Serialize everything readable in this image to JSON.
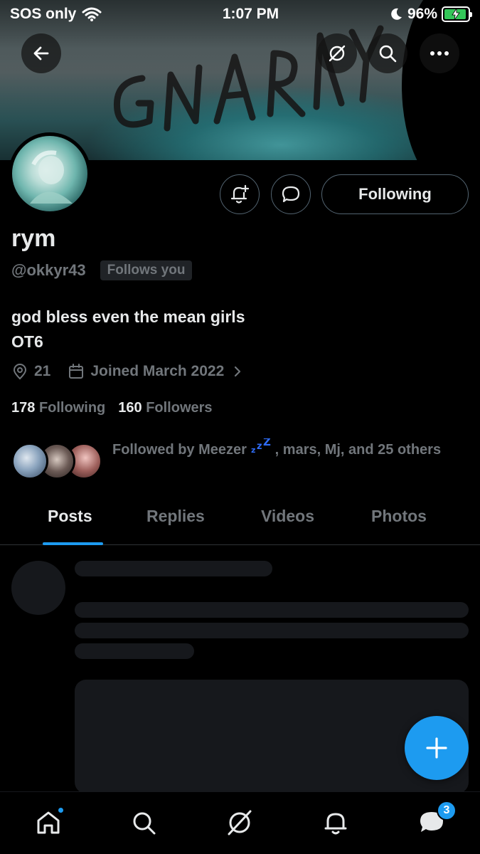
{
  "status_bar": {
    "carrier": "SOS only",
    "time": "1:07 PM",
    "battery": "96%",
    "battery_level": 0.96
  },
  "banner": {
    "graffiti_text": "GNARLY"
  },
  "profile": {
    "name": "rym",
    "handle": "@okkyr43",
    "follows_you": "Follows you",
    "bio_line1": "god bless even the mean girls",
    "bio_line2": "OT6",
    "location": "21",
    "joined": "Joined March 2022",
    "following_count": "178",
    "following_label": "Following",
    "followers_count": "160",
    "followers_label": "Followers",
    "followed_by_prefix": "Followed by Meezer",
    "followed_by_emoji": "zzz",
    "followed_by_suffix": ", mars, Mj, and 25 others"
  },
  "actions": {
    "following_button": "Following"
  },
  "tabs": [
    {
      "label": "Posts",
      "active": true
    },
    {
      "label": "Replies",
      "active": false
    },
    {
      "label": "Videos",
      "active": false
    },
    {
      "label": "Photos",
      "active": false
    }
  ],
  "bottom_nav": {
    "messages_badge": "3"
  },
  "colors": {
    "accent": "#1d9bf0",
    "background": "#000000",
    "secondary_text": "#71767b"
  },
  "icons": [
    "back-arrow-icon",
    "grok-icon",
    "search-icon",
    "more-icon",
    "notification-bell-plus-icon",
    "message-icon",
    "location-icon",
    "calendar-icon",
    "chevron-right-icon",
    "plus-icon",
    "home-icon",
    "search-icon",
    "grok-icon",
    "bell-icon",
    "messages-icon"
  ]
}
